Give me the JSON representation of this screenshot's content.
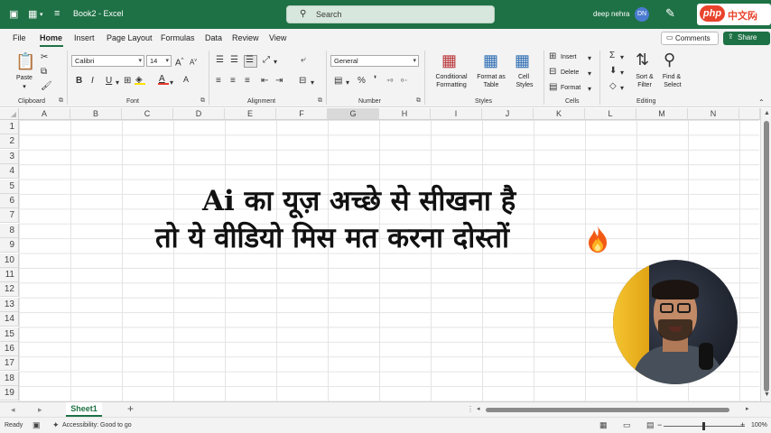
{
  "titlebar": {
    "file_title": "Book2 - Excel",
    "search_placeholder": "Search",
    "user_name": "deep nehra",
    "user_initials": "DN",
    "watermark_php": "php",
    "watermark_cn": "中文网"
  },
  "tabs": [
    "File",
    "Home",
    "Insert",
    "Page Layout",
    "Formulas",
    "Data",
    "Review",
    "View"
  ],
  "active_tab": "Home",
  "actions": {
    "comments": "Comments",
    "share": "Share"
  },
  "ribbon": {
    "clipboard": {
      "label": "Clipboard",
      "paste": "Paste"
    },
    "font": {
      "label": "Font",
      "font_name": "Calibri",
      "font_size": "14"
    },
    "alignment": {
      "label": "Alignment"
    },
    "number": {
      "label": "Number",
      "format": "General"
    },
    "styles": {
      "label": "Styles",
      "conditional_1": "Conditional",
      "conditional_2": "Formatting",
      "format_table_1": "Format as",
      "format_table_2": "Table",
      "cell_styles_1": "Cell",
      "cell_styles_2": "Styles"
    },
    "cells": {
      "label": "Cells",
      "insert": "Insert",
      "delete": "Delete",
      "format": "Format"
    },
    "editing": {
      "label": "Editing",
      "sort_1": "Sort &",
      "sort_2": "Filter",
      "find_1": "Find &",
      "find_2": "Select"
    }
  },
  "grid": {
    "columns": [
      "A",
      "B",
      "C",
      "D",
      "E",
      "F",
      "G",
      "H",
      "I",
      "J",
      "K",
      "L",
      "M",
      "N"
    ],
    "selected_column": "G",
    "rows": [
      "1",
      "2",
      "3",
      "4",
      "5",
      "6",
      "7",
      "8",
      "9",
      "10",
      "11",
      "12",
      "13",
      "14",
      "15",
      "16",
      "17",
      "18",
      "19"
    ]
  },
  "overlay": {
    "line1": "Ai का यूज़ अच्छे से सीखना है",
    "line2": "तो ये वीडियो मिस मत करना दोस्तों"
  },
  "sheets": {
    "active": "Sheet1"
  },
  "status": {
    "ready": "Ready",
    "accessibility": "Accessibility: Good to go",
    "zoom": "100%"
  },
  "colors": {
    "brand": "#1e7145",
    "overlay_text": "#111111"
  }
}
